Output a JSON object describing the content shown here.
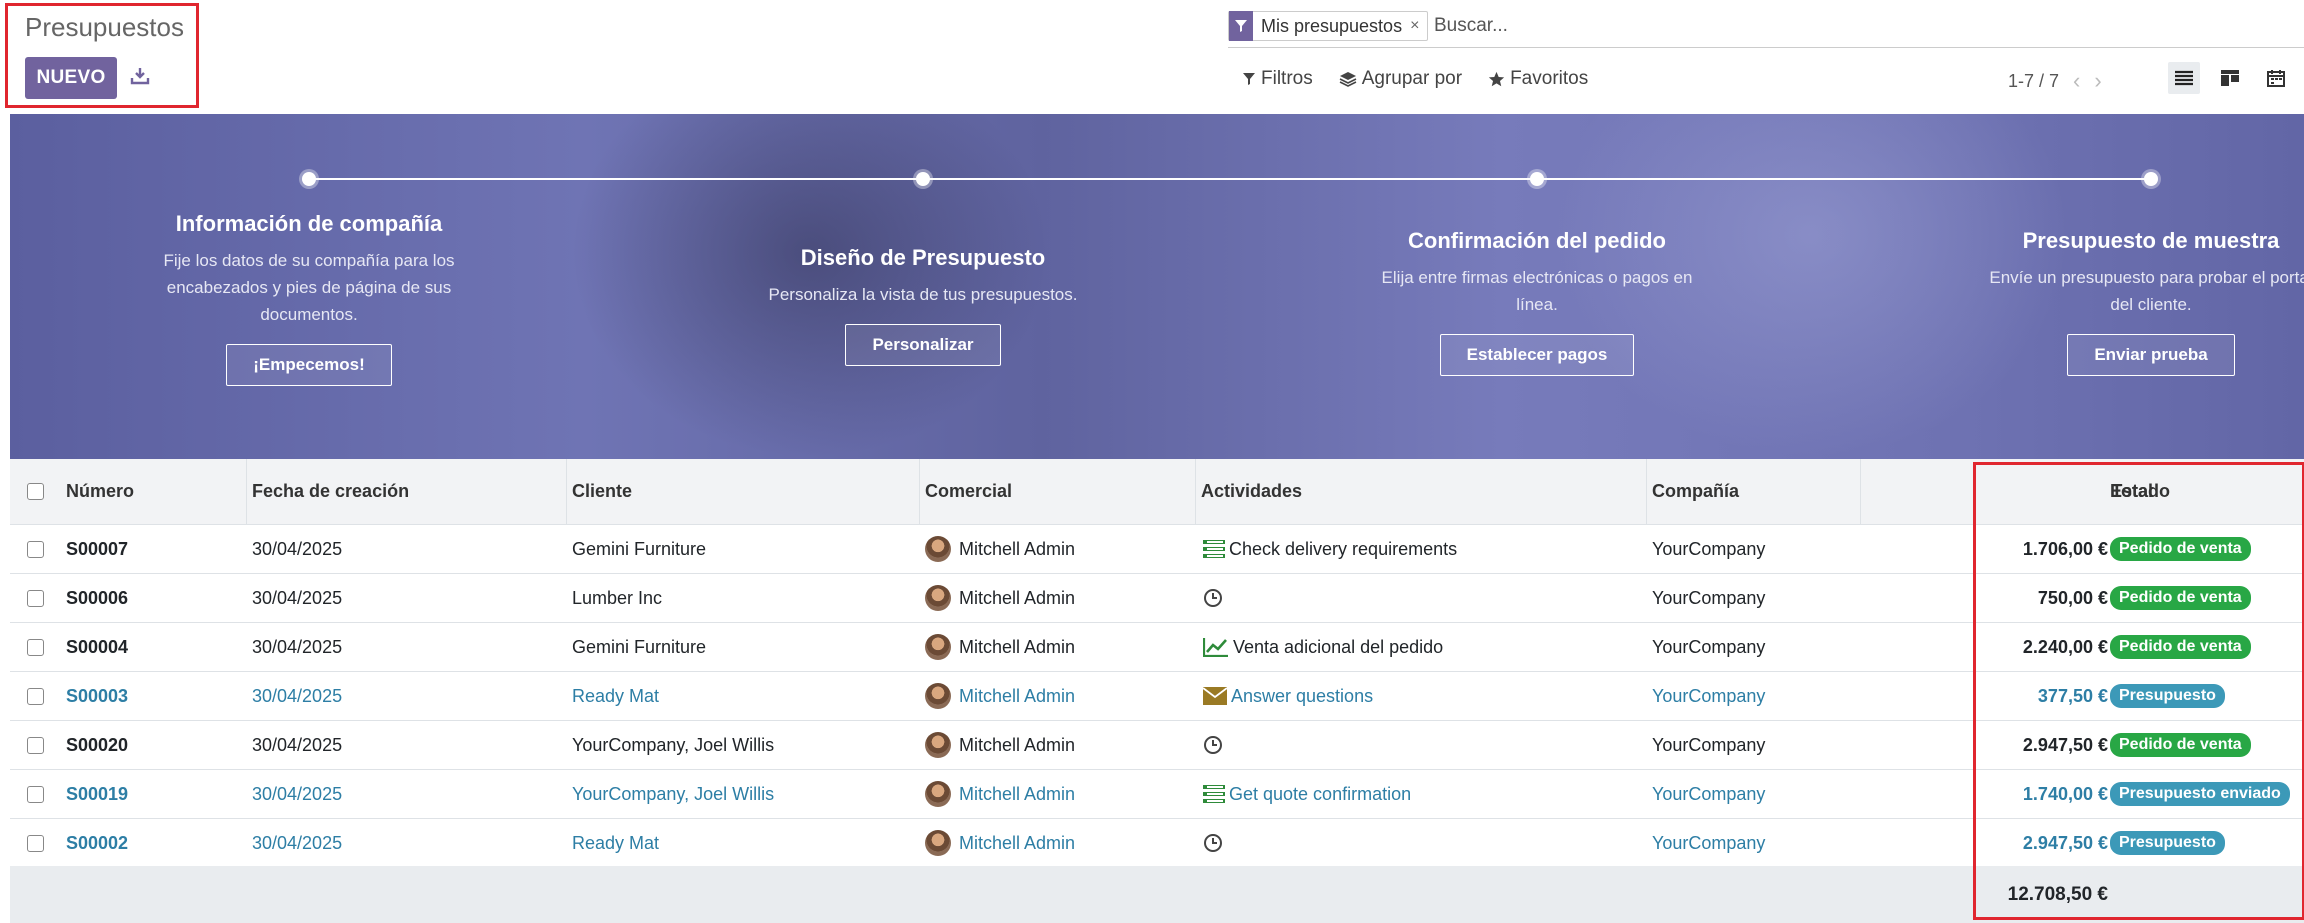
{
  "header": {
    "title": "Presupuestos",
    "new_label": "NUEVO",
    "facet_label": "Mis presupuestos",
    "facet_remove": "×",
    "search_placeholder": "Buscar...",
    "filters_label": "Filtros",
    "groupby_label": "Agrupar por",
    "favorites_label": "Favoritos",
    "pager": "1-7 / 7"
  },
  "banner": {
    "steps": [
      {
        "title": "Información de compañía",
        "desc": "Fije los datos de su compañía para los encabezados y pies de página de sus documentos.",
        "button": "¡Empecemos!"
      },
      {
        "title": "Diseño de Presupuesto",
        "desc": "Personaliza la vista de tus presupuestos.",
        "button": "Personalizar"
      },
      {
        "title": "Confirmación del pedido",
        "desc": "Elija entre firmas electrónicas o pagos en línea.",
        "button": "Establecer pagos"
      },
      {
        "title": "Presupuesto de muestra",
        "desc": "Envíe un presupuesto para probar el portal del cliente.",
        "button": "Enviar prueba"
      }
    ]
  },
  "table": {
    "columns": [
      "Número",
      "Fecha de creación",
      "Cliente",
      "Comercial",
      "Actividades",
      "Compañía",
      "Total",
      "Estado"
    ],
    "rows": [
      {
        "num": "S00007",
        "date": "30/04/2025",
        "client": "Gemini Furniture",
        "sales": "Mitchell Admin",
        "activity": "Check delivery requirements",
        "activity_icon": "list-icon",
        "company": "YourCompany",
        "total": "1.706,00 €",
        "state": "Pedido de venta",
        "state_type": "green",
        "link": false
      },
      {
        "num": "S00006",
        "date": "30/04/2025",
        "client": "Lumber Inc",
        "sales": "Mitchell Admin",
        "activity": "",
        "activity_icon": "clock-icon",
        "company": "YourCompany",
        "total": "750,00 €",
        "state": "Pedido de venta",
        "state_type": "green",
        "link": false
      },
      {
        "num": "S00004",
        "date": "30/04/2025",
        "client": "Gemini Furniture",
        "sales": "Mitchell Admin",
        "activity": "Venta adicional del pedido",
        "activity_icon": "chart-icon",
        "company": "YourCompany",
        "total": "2.240,00 €",
        "state": "Pedido de venta",
        "state_type": "green",
        "link": false
      },
      {
        "num": "S00003",
        "date": "30/04/2025",
        "client": "Ready Mat",
        "sales": "Mitchell Admin",
        "activity": "Answer questions",
        "activity_icon": "envelope-icon",
        "company": "YourCompany",
        "total": "377,50 €",
        "state": "Presupuesto",
        "state_type": "blue",
        "link": true
      },
      {
        "num": "S00020",
        "date": "30/04/2025",
        "client": "YourCompany, Joel Willis",
        "sales": "Mitchell Admin",
        "activity": "",
        "activity_icon": "clock-icon",
        "company": "YourCompany",
        "total": "2.947,50 €",
        "state": "Pedido de venta",
        "state_type": "green",
        "link": false
      },
      {
        "num": "S00019",
        "date": "30/04/2025",
        "client": "YourCompany, Joel Willis",
        "sales": "Mitchell Admin",
        "activity": "Get quote confirmation",
        "activity_icon": "list-icon",
        "company": "YourCompany",
        "total": "1.740,00 €",
        "state": "Presupuesto enviado",
        "state_type": "blue",
        "link": true
      },
      {
        "num": "S00002",
        "date": "30/04/2025",
        "client": "Ready Mat",
        "sales": "Mitchell Admin",
        "activity": "",
        "activity_icon": "clock-icon",
        "company": "YourCompany",
        "total": "2.947,50 €",
        "state": "Presupuesto",
        "state_type": "blue",
        "link": true
      }
    ],
    "grand_total": "12.708,50 €"
  },
  "colors": {
    "primary": "#71639e",
    "link": "#2d7ea5",
    "green": "#28a745",
    "blue": "#3c99b8",
    "highlight": "#e0262f"
  }
}
